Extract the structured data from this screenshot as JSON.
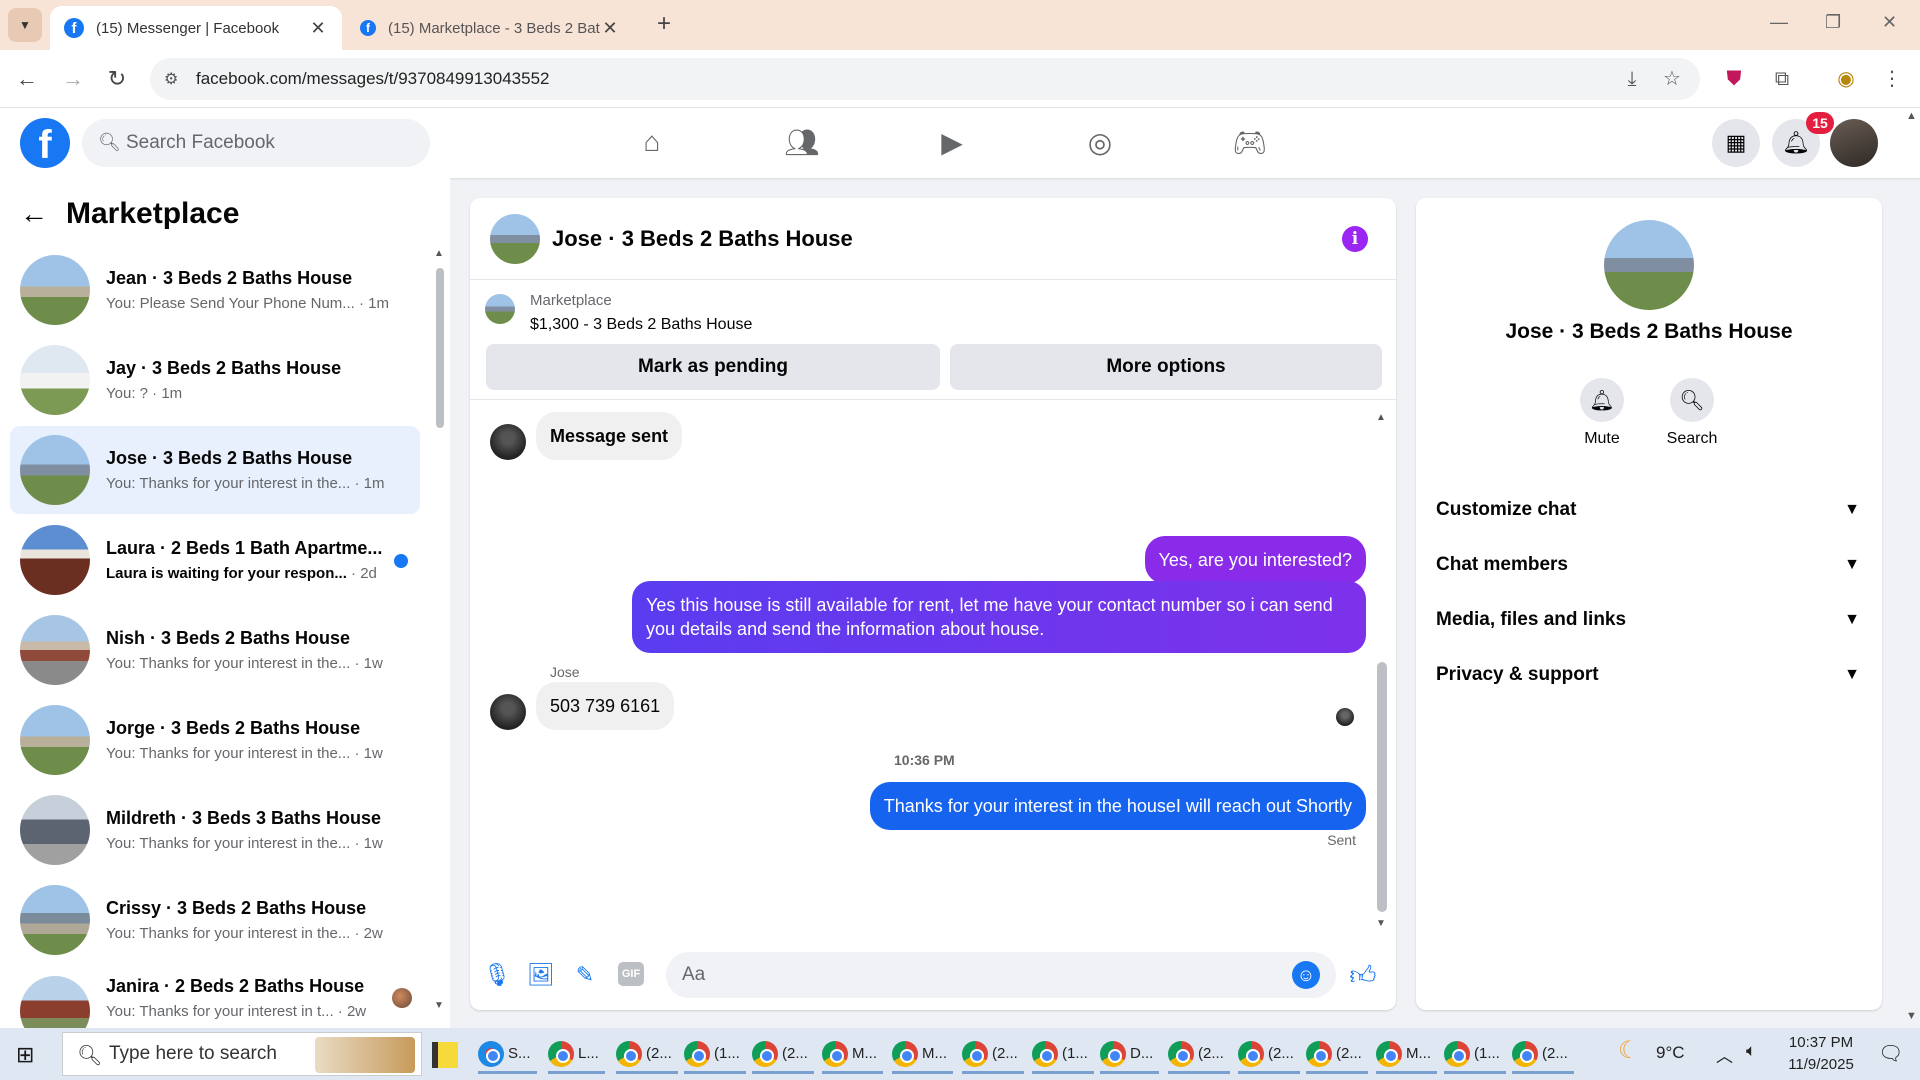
{
  "browser": {
    "tabs": [
      {
        "title": "(15) Messenger | Facebook",
        "active": true
      },
      {
        "title": "(15) Marketplace - 3 Beds 2 Bat",
        "active": false
      }
    ],
    "url": "facebook.com/messages/t/9370849913043552"
  },
  "fb_header": {
    "logo": "f",
    "search_placeholder": "Search Facebook",
    "notification_count": "15"
  },
  "sidebar": {
    "title": "Marketplace",
    "conversations": [
      {
        "name": "Jean · 3 Beds 2 Baths House",
        "preview": "You: Please Send Your Phone Num...",
        "time": "· 1m",
        "selected": false,
        "unread": false
      },
      {
        "name": "Jay · 3 Beds 2 Baths House",
        "preview": "You: ?",
        "time": "· 1m",
        "selected": false,
        "unread": false
      },
      {
        "name": "Jose · 3 Beds 2 Baths House",
        "preview": "You: Thanks for your interest in the...",
        "time": "· 1m",
        "selected": true,
        "unread": false
      },
      {
        "name": "Laura · 2 Beds 1 Bath Apartme...",
        "preview": "Laura is waiting for your respon...",
        "time": "· 2d",
        "selected": false,
        "unread": true
      },
      {
        "name": "Nish · 3 Beds 2 Baths House",
        "preview": "You: Thanks for your interest in the...",
        "time": "· 1w",
        "selected": false,
        "unread": false
      },
      {
        "name": "Jorge · 3 Beds 2 Baths House",
        "preview": "You: Thanks for your interest in the...",
        "time": "· 1w",
        "selected": false,
        "unread": false
      },
      {
        "name": "Mildreth · 3 Beds 3 Baths House",
        "preview": "You: Thanks for your interest in the...",
        "time": "· 1w",
        "selected": false,
        "unread": false
      },
      {
        "name": "Crissy · 3 Beds 2 Baths House",
        "preview": "You: Thanks for your interest in the...",
        "time": "· 2w",
        "selected": false,
        "unread": false
      },
      {
        "name": "Janira · 2 Beds 2 Baths House",
        "preview": "You: Thanks for your interest in t...",
        "time": "· 2w",
        "selected": false,
        "unread": false
      }
    ]
  },
  "chat": {
    "title": "Jose · 3 Beds 2 Baths House",
    "listing_label": "Marketplace",
    "listing_title": "$1,300 - 3 Beds 2 Baths House",
    "mark_pending_label": "Mark as pending",
    "more_options_label": "More options",
    "messages": {
      "m1": "Message sent",
      "m2": "Yes, are you interested?",
      "m3": "Yes this house is still available for rent, let me have your contact number so i can send you details and send the information about house.",
      "m4_sender": "Jose",
      "m4": "503 739 6161",
      "timestamp": "10:36 PM",
      "m5": "Thanks for your interest in the houseI will reach out Shortly",
      "status": "Sent"
    },
    "composer_placeholder": "Aa",
    "gif_label": "GIF"
  },
  "right_panel": {
    "name": "Jose · 3 Beds 2 Baths House",
    "mute_label": "Mute",
    "search_label": "Search",
    "sections": [
      "Customize chat",
      "Chat members",
      "Media, files and links",
      "Privacy & support"
    ]
  },
  "taskbar": {
    "search_placeholder": "Type here to search",
    "apps": [
      "S...",
      "L...",
      "(2...",
      "(1...",
      "(2...",
      "M...",
      "M...",
      "(2...",
      "(1...",
      "D...",
      "(2...",
      "(2...",
      "(2...",
      "M...",
      "(1...",
      "(2..."
    ],
    "weather": "9°C",
    "time": "10:37 PM",
    "date": "11/9/2025"
  },
  "colors": {
    "fb_blue": "#1877f2",
    "purple_bubble": "#8a2bea",
    "blue_bubble": "#1663f0",
    "selected_bg": "#e7f0fc"
  }
}
